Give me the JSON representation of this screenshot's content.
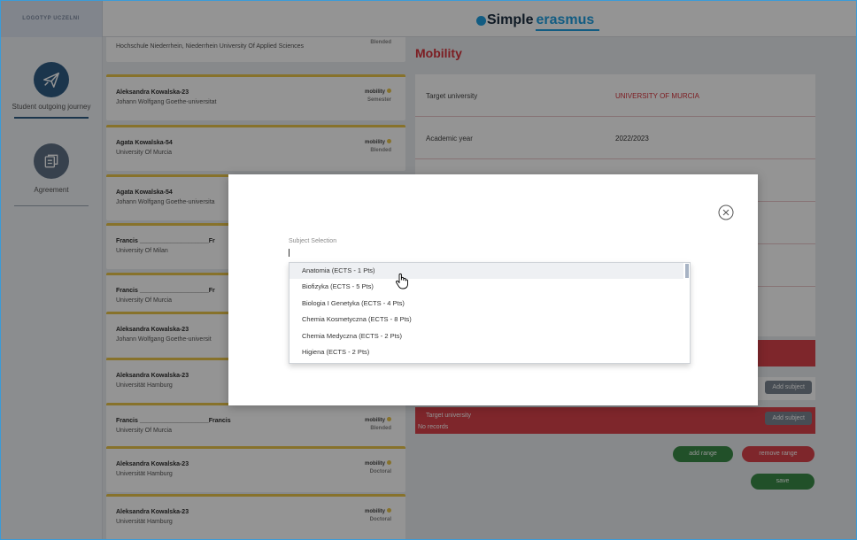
{
  "header": {
    "logo_placeholder": "LOGOTYP UCZELNI",
    "brand_simple": "Simple",
    "brand_erasmus": "erasmus"
  },
  "sidebar": {
    "items": [
      {
        "label": "Student outgoing journey",
        "icon": "airplane-icon",
        "active": true
      },
      {
        "label": "Agreement",
        "icon": "documents-icon",
        "active": false
      }
    ]
  },
  "mobility_list": [
    {
      "name": "",
      "university": "Hochschule Niederrhein, Niederrhein University Of Applied Sciences",
      "mobility": "",
      "type": "Blended"
    },
    {
      "name": "Aleksandra Kowalska-23",
      "university": "Johann Wolfgang Goethe-universitat",
      "mobility": "mobility",
      "type": "Semester"
    },
    {
      "name": "Agata Kowalska-54",
      "university": "University Of Murcia",
      "mobility": "mobility",
      "type": "Blended"
    },
    {
      "name": "Agata Kowalska-54",
      "university": "Johann Wolfgang Goethe-universita",
      "mobility": "",
      "type": ""
    },
    {
      "name": "Francis ____________________Fr",
      "university": "University Of Milan",
      "mobility": "",
      "type": ""
    },
    {
      "name": "Francis ____________________Fr",
      "university": "University Of Murcia",
      "mobility": "",
      "type": ""
    },
    {
      "name": "Aleksandra Kowalska-23",
      "university": "Johann Wolfgang Goethe-universit",
      "mobility": "",
      "type": ""
    },
    {
      "name": "Aleksandra Kowalska-23",
      "university": "Universität Hamburg",
      "mobility": "",
      "type": ""
    },
    {
      "name": "Francis ____________________Francis",
      "university": "University Of Murcia",
      "mobility": "mobility",
      "type": "Blended"
    },
    {
      "name": "Aleksandra Kowalska-23",
      "university": "Universität Hamburg",
      "mobility": "mobility",
      "type": "Doctoral"
    },
    {
      "name": "Aleksandra Kowalska-23",
      "university": "Universität Hamburg",
      "mobility": "mobility",
      "type": "Doctoral"
    }
  ],
  "mobility_panel": {
    "title": "Mobility",
    "rows": [
      {
        "label": "Target university",
        "value": "UNIVERSITY OF MURCIA"
      },
      {
        "label": "Academic year",
        "value": "2022/2023"
      }
    ],
    "add_subject_label": "Add subject",
    "target_university_label": "Target university",
    "no_records": "No records",
    "add_range": "add range",
    "remove_range": "remove range",
    "save": "save"
  },
  "modal": {
    "subject_selection_label": "Subject Selection",
    "input_value": "",
    "options": [
      "Anatomia (ECTS - 1 Pts)",
      "Biofizyka (ECTS - 5 Pts)",
      "Biologia I Genetyka (ECTS - 4 Pts)",
      "Chemia Kosmetyczna (ECTS - 8 Pts)",
      "Chemia Medyczna (ECTS - 2 Pts)",
      "Higiena (ECTS - 2 Pts)"
    ]
  },
  "colors": {
    "accent_red": "#d9434b",
    "accent_yellow": "#e9c44a",
    "brand_blue": "#1f9fe0",
    "sidebar_icon": "#2f5c84",
    "green": "#3a8b47"
  }
}
